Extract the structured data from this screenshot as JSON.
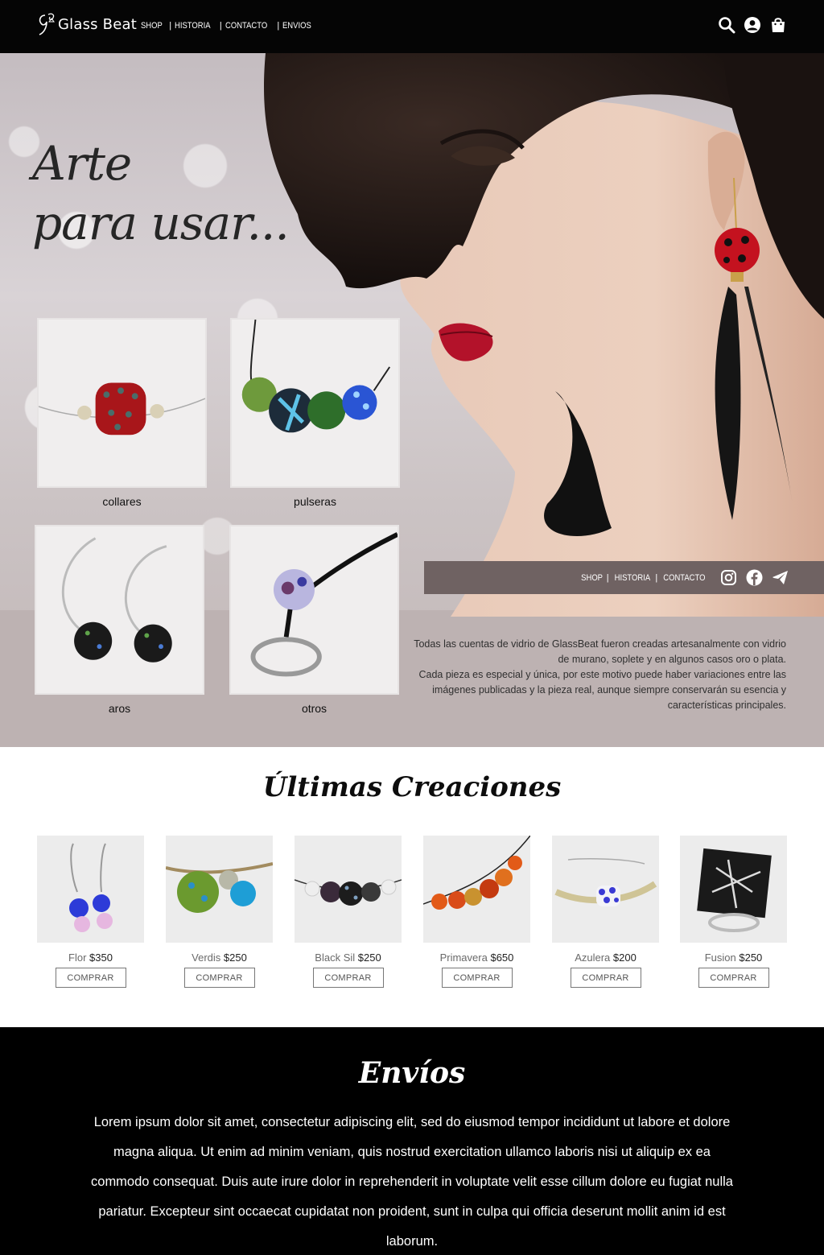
{
  "header": {
    "brand": "Glass Beat",
    "nav": [
      {
        "label": "SHOP"
      },
      {
        "label": "HISTORIA"
      },
      {
        "label": "CONTACTO"
      },
      {
        "label": "ENVIOS"
      }
    ],
    "icons": [
      "search-icon",
      "user-icon",
      "shopping-bag-icon"
    ]
  },
  "hero": {
    "title_line1": "Arte",
    "title_line2": "para usar...",
    "categories": [
      {
        "label": "collares"
      },
      {
        "label": "pulseras"
      },
      {
        "label": "aros"
      },
      {
        "label": "otros"
      }
    ],
    "subnav": [
      {
        "label": "SHOP"
      },
      {
        "label": "HISTORIA"
      },
      {
        "label": "CONTACTO"
      }
    ],
    "social_icons": [
      "instagram-icon",
      "facebook-icon",
      "telegram-icon"
    ],
    "disclaimer_line1": "Todas las cuentas de vidrio de GlassBeat fueron creadas artesanalmente con vidrio de murano, soplete y en algunos casos oro o plata.",
    "disclaimer_line2": "Cada pieza es especial y única, por este motivo puede haber variaciones entre las imágenes publicadas y la pieza real, aunque siempre conservarán su esencia y características principales."
  },
  "latest": {
    "title": "Últimas Creaciones",
    "buy_label": "COMPRAR",
    "products": [
      {
        "name": "Flor",
        "price": "$350"
      },
      {
        "name": "Verdis",
        "price": "$250"
      },
      {
        "name": "Black Sil",
        "price": "$250"
      },
      {
        "name": "Primavera",
        "price": "$650"
      },
      {
        "name": "Azulera",
        "price": "$200"
      },
      {
        "name": "Fusion",
        "price": "$250"
      }
    ]
  },
  "shipping": {
    "title": "Envíos",
    "text": "Lorem ipsum dolor sit amet, consectetur adipiscing elit, sed do eiusmod tempor incididunt ut labore et dolore magna aliqua. Ut enim ad minim veniam, quis nostrud exercitation ullamco laboris nisi ut aliquip ex ea commodo consequat. Duis aute irure dolor in reprehenderit in voluptate velit esse cillum dolore eu fugiat nulla pariatur. Excepteur sint occaecat cupidatat non proident, sunt in culpa qui officia deserunt mollit anim id est laborum."
  },
  "colors": {
    "topbar": "#050505",
    "hero_lower": "#bdb2b2",
    "subbar": "#6f6262",
    "footer": "#000000"
  }
}
